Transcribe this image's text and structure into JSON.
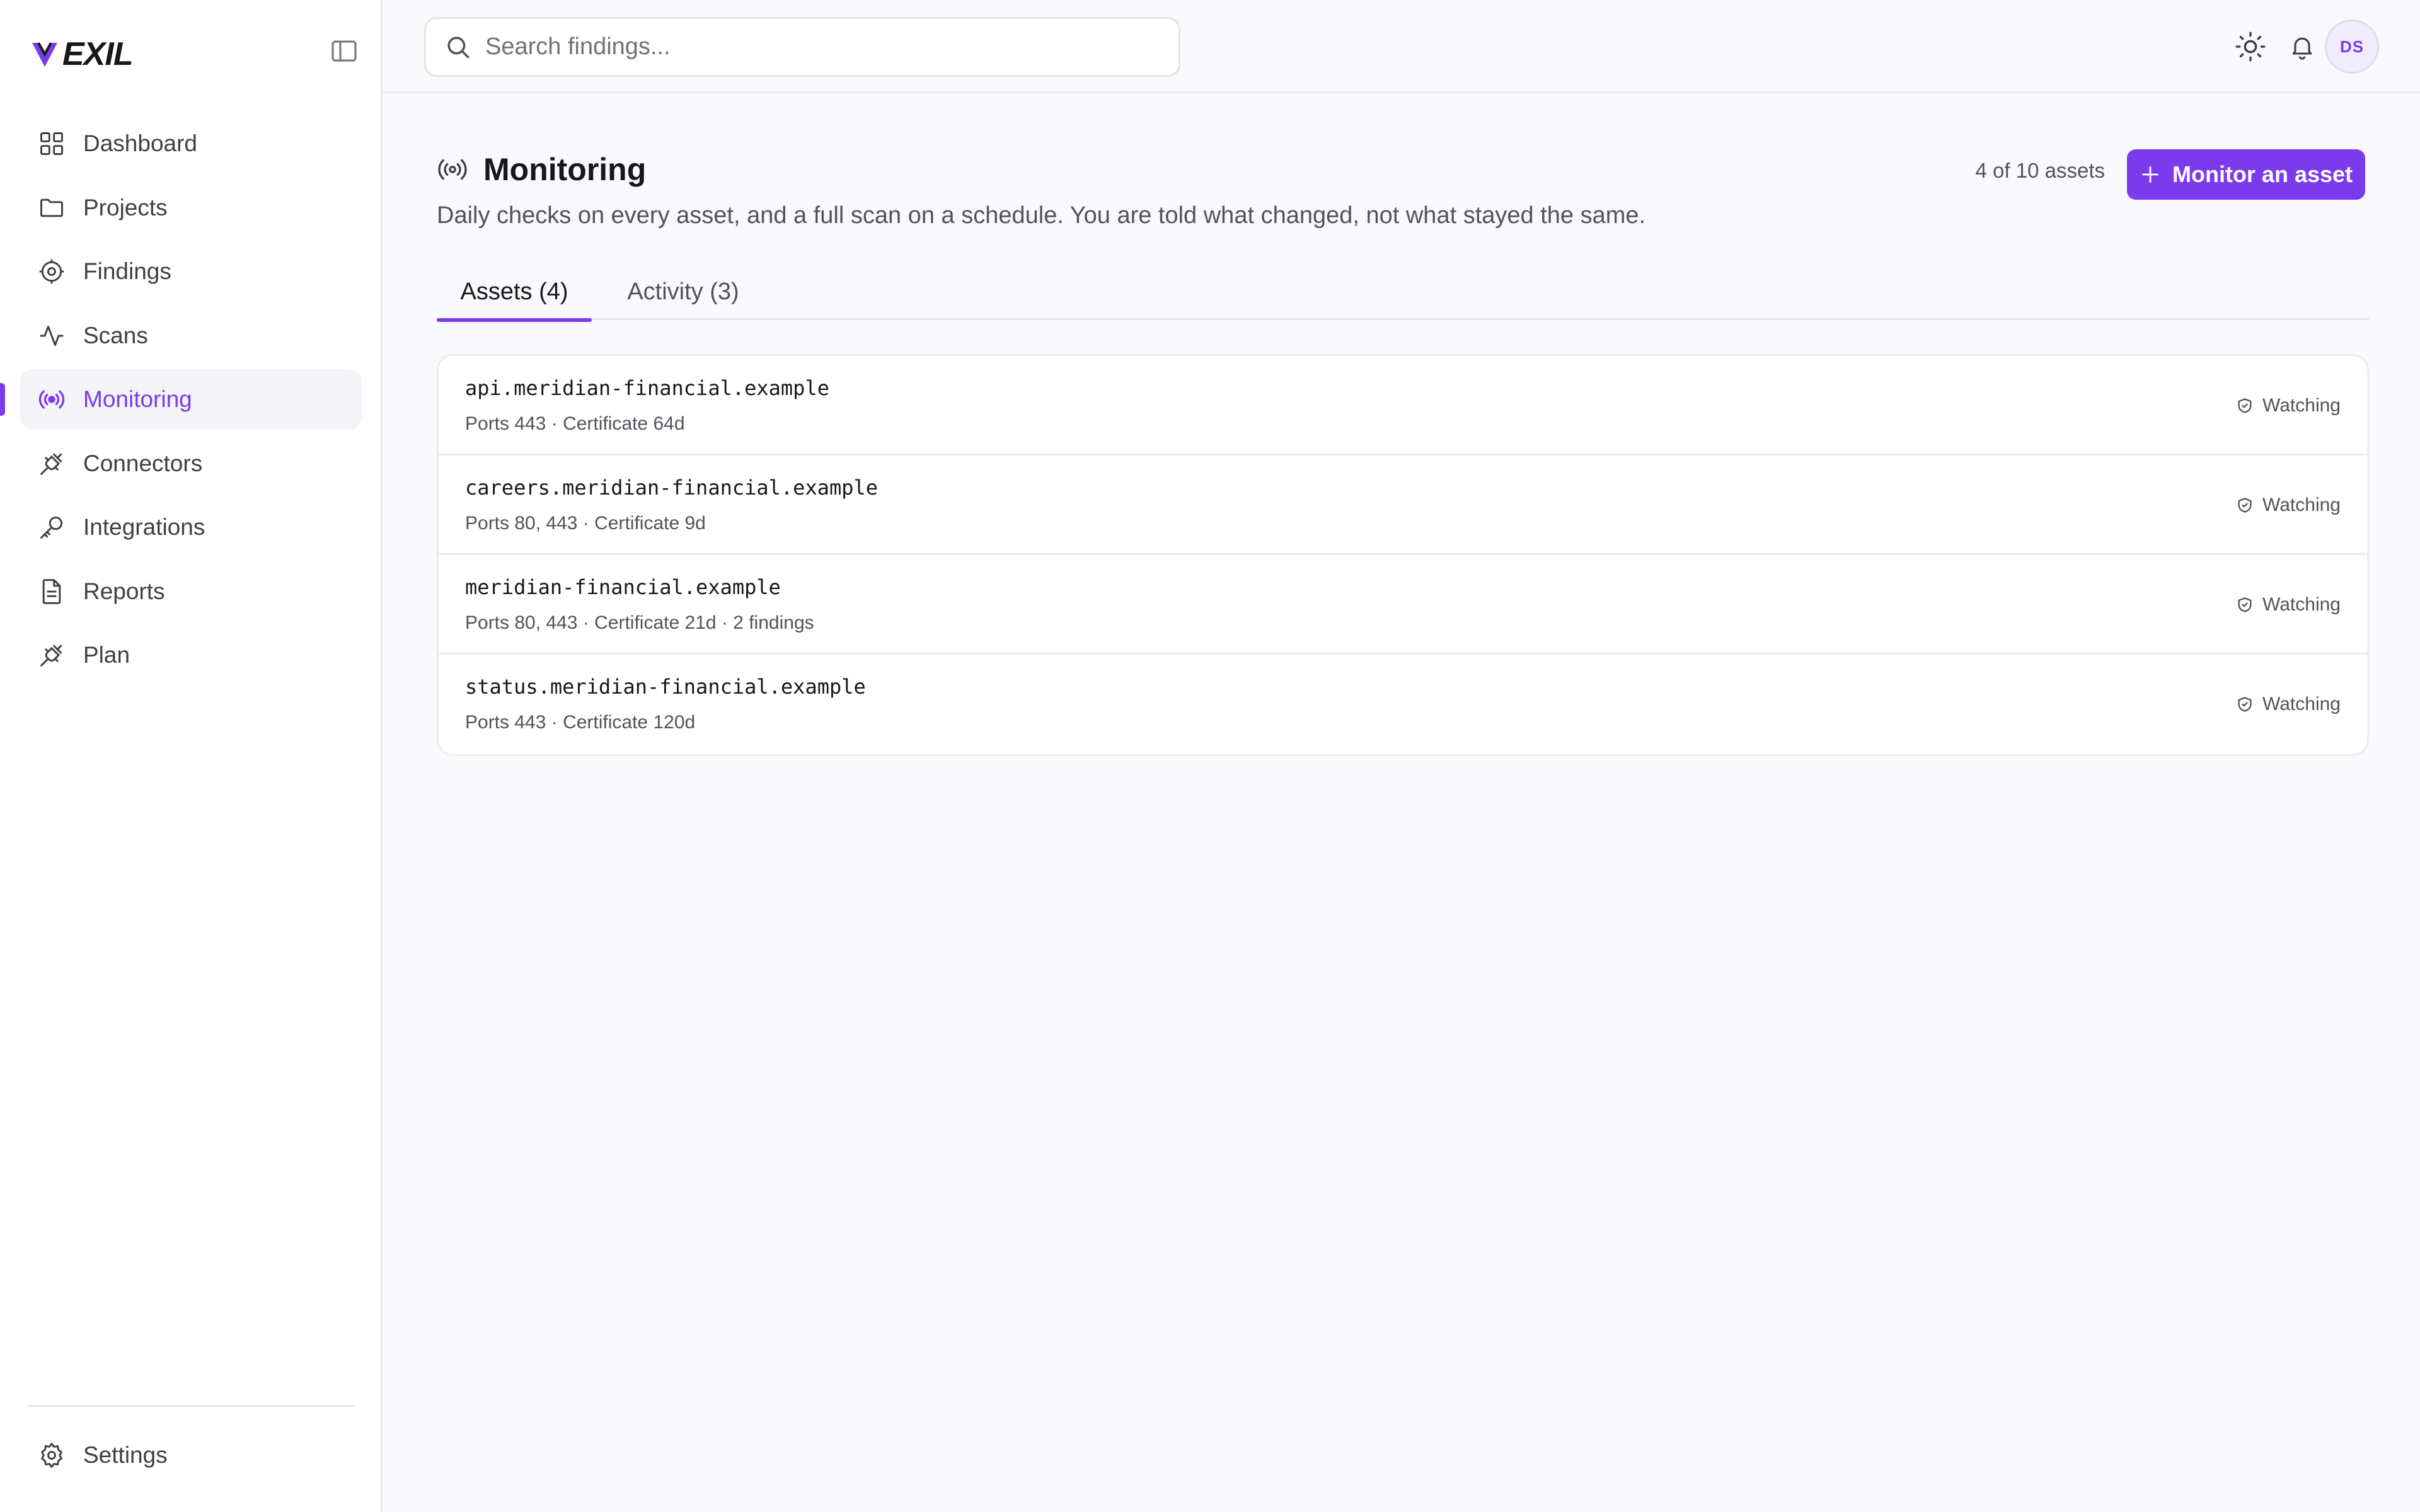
{
  "brand": {
    "name": "EXIL",
    "accent": "#7c3aed"
  },
  "sidebar": {
    "items": [
      {
        "label": "Dashboard",
        "icon": "grid-icon"
      },
      {
        "label": "Projects",
        "icon": "folder-icon"
      },
      {
        "label": "Findings",
        "icon": "target-icon"
      },
      {
        "label": "Scans",
        "icon": "activity-icon"
      },
      {
        "label": "Monitoring",
        "icon": "radio-icon",
        "active": true
      },
      {
        "label": "Connectors",
        "icon": "plug-icon"
      },
      {
        "label": "Integrations",
        "icon": "key-icon"
      },
      {
        "label": "Reports",
        "icon": "file-text-icon"
      },
      {
        "label": "Plan",
        "icon": "plug-icon"
      }
    ],
    "settings_label": "Settings"
  },
  "header": {
    "search_placeholder": "Search findings...",
    "avatar_initials": "DS"
  },
  "page": {
    "title": "Monitoring",
    "subtitle": "Daily checks on every asset, and a full scan on a schedule. You are told what changed, not what stayed the same.",
    "asset_count": "4 of 10 assets",
    "primary_button": "Monitor an asset"
  },
  "tabs": [
    {
      "label": "Assets (4)",
      "active": true
    },
    {
      "label": "Activity (3)",
      "active": false
    }
  ],
  "assets": [
    {
      "name": "api.meridian-financial.example",
      "meta": "Ports 443 · Certificate 64d",
      "status": "Watching"
    },
    {
      "name": "careers.meridian-financial.example",
      "meta": "Ports 80, 443 · Certificate 9d",
      "status": "Watching"
    },
    {
      "name": "meridian-financial.example",
      "meta": "Ports 80, 443 · Certificate 21d · 2 findings",
      "status": "Watching"
    },
    {
      "name": "status.meridian-financial.example",
      "meta": "Ports 443 · Certificate 120d",
      "status": "Watching"
    }
  ]
}
